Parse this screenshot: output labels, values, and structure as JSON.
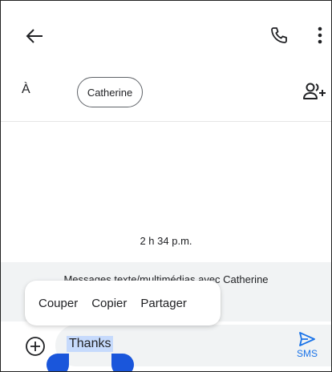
{
  "header": {
    "back_icon": "arrow-left-icon",
    "call_icon": "phone-icon",
    "more_icon": "more-vert-icon"
  },
  "recipients": {
    "to_label": "À",
    "chip_name": "Catherine",
    "add_icon": "add-person-icon"
  },
  "conversation": {
    "timestamp": "2 h 34 p.m.",
    "info_text": "Messages texte/multimédias avec Catherine"
  },
  "context_menu": {
    "items": [
      "Couper",
      "Copier",
      "Partager"
    ]
  },
  "compose": {
    "attach_icon": "add-circle-icon",
    "text": "Thanks",
    "send_label": "SMS",
    "send_icon": "send-icon",
    "accent_color": "#1a73e8",
    "selection_color": "#c6dafc",
    "handle_color": "#1a56db"
  }
}
